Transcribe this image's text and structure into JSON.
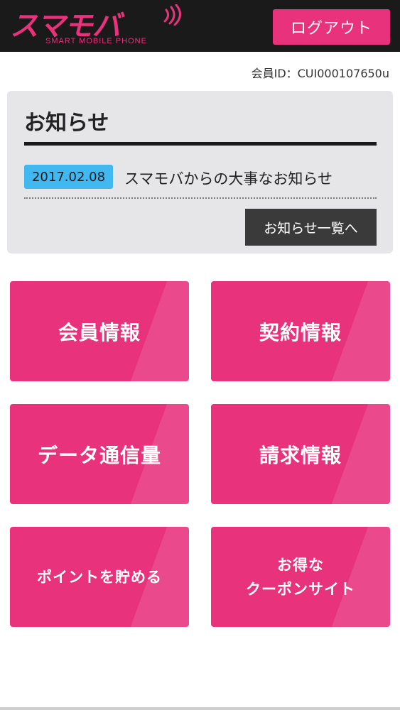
{
  "header": {
    "logo_text": "スマモバ",
    "logo_sub": "SMART MOBILE PHONE",
    "logout_label": "ログアウト"
  },
  "member_id": "会員ID：CUI000107650u",
  "news": {
    "title": "お知らせ",
    "items": [
      {
        "date": "2017.02.08",
        "text": "スマモバからの大事なお知らせ"
      }
    ],
    "list_button": "お知らせ一覧へ"
  },
  "menu": {
    "member_info": "会員情報",
    "contract_info": "契約情報",
    "data_usage": "データ通信量",
    "billing_info": "請求情報",
    "points": "ポイントを貯める",
    "coupon_line1": "お得な",
    "coupon_line2": "クーポンサイト"
  },
  "colors": {
    "accent": "#e8327b",
    "header_bg": "#1a1a1a",
    "date_badge": "#42b8f0",
    "panel_bg": "#e6e6e8"
  }
}
